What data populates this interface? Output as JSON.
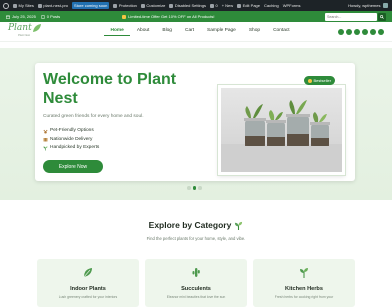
{
  "adminbar": {
    "items": [
      "My Sites",
      "plant-nest-pro",
      "Store coming soon",
      "Protection",
      "Customize",
      "Disabled Settings",
      "",
      "0",
      "+ New",
      "Edit Page",
      "Caching",
      "WPForms"
    ],
    "user": "Howdy, wpthemes"
  },
  "topstrip": {
    "date": "July 25, 2025",
    "posts": "0 Posts",
    "promo": "Limited-time Offer Get 10% OFF on All Products!",
    "search_placeholder": "Search..."
  },
  "header": {
    "logo_text": "Plant",
    "logo_tagline": "Plant Nest",
    "nav": [
      "Home",
      "About",
      "Blog",
      "Cart",
      "Sample Page",
      "Shop",
      "Contact"
    ],
    "active_nav": "Home"
  },
  "hero": {
    "title": "Welcome to Plant Nest",
    "subtitle": "Curated green friends for every home and soul.",
    "features": [
      "Pet-Friendly Options",
      "Nationwide Delivery",
      "Handpicked by Experts"
    ],
    "cta": "Explore Now",
    "badge": "Bestseller"
  },
  "categories": {
    "title": "Explore by Category",
    "subtitle": "Find the perfect plants for your home, style, and vibe.",
    "cards": [
      {
        "name": "Indoor Plants",
        "desc": "Lush greenery crafted for your interiors"
      },
      {
        "name": "Succulents",
        "desc": "Eleanor mini beauties that love the sun"
      },
      {
        "name": "Kitchen Herbs",
        "desc": "Fresh herbs for cooking right from your"
      }
    ]
  },
  "colors": {
    "brand_green": "#2e8b3a",
    "admin_bar": "#1d2327",
    "hero_bg": "#e3f0e0"
  }
}
